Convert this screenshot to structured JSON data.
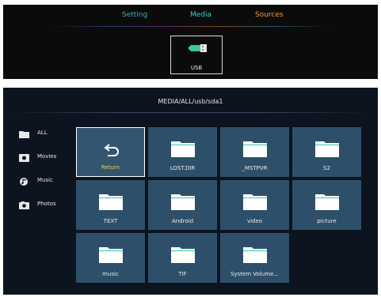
{
  "top_tabs": {
    "setting": "Setting",
    "media": "Media",
    "sources": "Sources"
  },
  "usb_source": {
    "label": "USB",
    "icon": "usb-drive-icon"
  },
  "browser": {
    "path": "MEDIA/ALL/usb/sda1",
    "sidebar": [
      {
        "label": "ALL",
        "icon": "folder-icon"
      },
      {
        "label": "Movies",
        "icon": "movie-icon"
      },
      {
        "label": "Music",
        "icon": "music-icon"
      },
      {
        "label": "Photos",
        "icon": "photo-icon"
      }
    ],
    "items": [
      {
        "label": "Return",
        "icon": "return-icon"
      },
      {
        "label": "LOST.DIR",
        "icon": "folder-icon"
      },
      {
        "label": "_MSTPVR",
        "icon": "folder-icon"
      },
      {
        "label": "S2",
        "icon": "folder-icon"
      },
      {
        "label": "TEXT",
        "icon": "folder-icon"
      },
      {
        "label": "Android",
        "icon": "folder-icon"
      },
      {
        "label": "video",
        "icon": "folder-icon"
      },
      {
        "label": "picture",
        "icon": "folder-icon"
      },
      {
        "label": "music",
        "icon": "folder-icon"
      },
      {
        "label": "TIF",
        "icon": "folder-icon"
      },
      {
        "label": "System Volume...",
        "icon": "folder-icon"
      }
    ]
  },
  "colors": {
    "setting": "#3fa7d8",
    "media": "#2fd6c9",
    "sources": "#f0a03c",
    "tile": "#2e4f6a",
    "selected_label": "#f2d23c"
  }
}
